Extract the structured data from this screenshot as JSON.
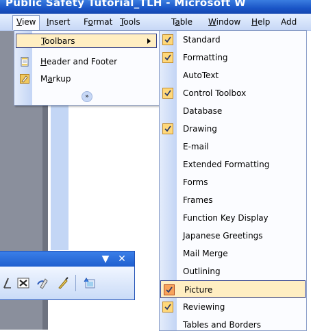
{
  "window": {
    "title": "Public Safety Tutorial_TLH - Microsoft W"
  },
  "menubar": {
    "items": [
      {
        "label": "View",
        "key": "V",
        "rest": "iew"
      },
      {
        "label": "Insert",
        "key": "I",
        "rest": "nsert"
      },
      {
        "label": "Format",
        "key": "o",
        "pre": "F",
        "rest": "rmat"
      },
      {
        "label": "Tools",
        "key": "T",
        "rest": "ools"
      },
      {
        "label": "Table",
        "key": "a",
        "pre": "T",
        "rest": "ble"
      },
      {
        "label": "Window",
        "key": "W",
        "rest": "indow"
      },
      {
        "label": "Help",
        "key": "H",
        "rest": "elp"
      },
      {
        "label": "Add",
        "rest": "Add"
      }
    ]
  },
  "view_menu": {
    "items": [
      {
        "label": "Toolbars",
        "key": "T",
        "rest": "oolbars",
        "has_submenu": true,
        "highlighted": true
      },
      {
        "label": "Header and Footer",
        "key": "H",
        "rest": "eader and Footer",
        "icon": "header-footer-icon"
      },
      {
        "label": "Markup",
        "key": "a",
        "pre": "M",
        "rest": "rkup",
        "icon": "markup-icon"
      }
    ],
    "expand_icon": "expand-chevron-icon"
  },
  "toolbars_submenu": {
    "items": [
      {
        "label": "Standard",
        "checked": true
      },
      {
        "label": "Formatting",
        "checked": true
      },
      {
        "label": "AutoText",
        "checked": false
      },
      {
        "label": "Control Toolbox",
        "checked": true
      },
      {
        "label": "Database",
        "checked": false
      },
      {
        "label": "Drawing",
        "checked": true
      },
      {
        "label": "E-mail",
        "checked": false
      },
      {
        "label": "Extended Formatting",
        "checked": false
      },
      {
        "label": "Forms",
        "checked": false
      },
      {
        "label": "Frames",
        "checked": false
      },
      {
        "label": "Function Key Display",
        "checked": false
      },
      {
        "label": "Japanese Greetings",
        "checked": false
      },
      {
        "label": "Mail Merge",
        "checked": false
      },
      {
        "label": "Outlining",
        "checked": false
      },
      {
        "label": "Picture",
        "checked": true,
        "highlighted": true
      },
      {
        "label": "Reviewing",
        "checked": true
      },
      {
        "label": "Tables and Borders",
        "checked": false
      }
    ]
  },
  "floating_toolbar": {
    "dropdown_icon": "toolbar-options-icon",
    "close_icon": "close-icon",
    "icons": [
      "crop-icon",
      "text-wrapping-icon",
      "format-picture-icon",
      "set-transparent-color-icon",
      "reset-picture-icon"
    ]
  },
  "colors": {
    "menu_highlight": "#ffeec2",
    "menu_highlight_border": "#313f8a",
    "check_background": "#ffd87a",
    "titlebar": "#1a55c7"
  }
}
